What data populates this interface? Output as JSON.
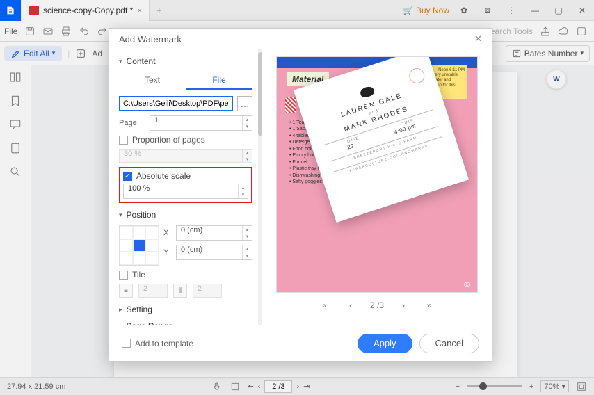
{
  "titlebar": {
    "tab_name": "science-copy-Copy.pdf *",
    "buy_now": "Buy Now",
    "add_tab": "+"
  },
  "menubar": {
    "file": "File",
    "search_tools": "Search Tools"
  },
  "toolbar": {
    "edit_all": "Edit All",
    "add": "Ad",
    "bates_number": "Bates Number"
  },
  "statusbar": {
    "dims": "27.94 x 21.59 cm",
    "page_value": "2 /3",
    "zoom_value": "70%"
  },
  "modal": {
    "title": "Add Watermark",
    "sections": {
      "content": "Content",
      "position": "Position",
      "setting": "Setting",
      "page_range": "Page Range"
    },
    "tabs": {
      "text": "Text",
      "file": "File"
    },
    "fields": {
      "path": "C:\\Users\\Geili\\Desktop\\PDF\\perform o",
      "browse": "…",
      "page_label": "Page",
      "page_value": "1",
      "proportion_label": "Proportion of pages",
      "proportion_value": "30 %",
      "absolute_label": "Absolute scale",
      "absolute_value": "100 %",
      "x_label": "X",
      "x_value": "0 (cm)",
      "y_label": "Y",
      "y_value": "0 (cm)",
      "tile_label": "Tile",
      "tile_v1": "2",
      "tile_v2": "2"
    },
    "preview": {
      "materials": "Material",
      "sticky_time": "Noon 6:11 PM",
      "sticky_body": "Some molecules are very unstable and break down into water and oxygen gas. The equation for this decomposition is:",
      "bullets": [
        "1 Teaspoon",
        "1 Sac…",
        "4 tablesps",
        "Detergent",
        "Food color",
        "Empty bottle",
        "Funnel",
        "Plastic tray or tub",
        "Dishwashing gloves",
        "Safty goggles"
      ],
      "footer_num": "03",
      "wm_name1": "LAUREN GALE",
      "wm_and": "and",
      "wm_name2": "MARK RHODES",
      "wm_row1": [
        "DATE",
        "TIME"
      ],
      "wm_row2": [
        "22",
        "4:00 pm"
      ],
      "wm_venue": "BREEZEPORT HILLS FARM",
      "wm_url": "PAPERCULTURE.CO/LANDMARKS",
      "nav_label": "2 /3"
    },
    "footer": {
      "add_template": "Add to template",
      "apply": "Apply",
      "cancel": "Cancel"
    }
  }
}
